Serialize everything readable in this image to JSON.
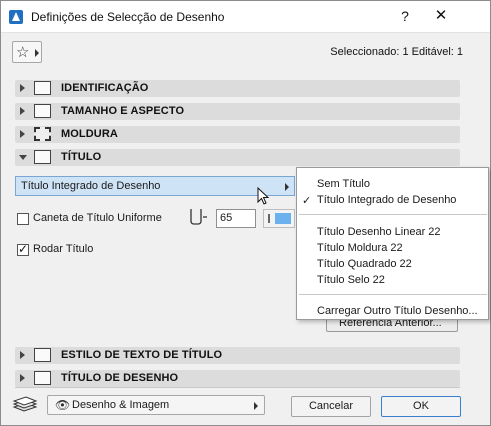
{
  "window": {
    "title": "Definições de Selecção de Desenho",
    "help_label": "?",
    "close_label": "✕"
  },
  "header": {
    "selected_info": "Seleccionado: 1 Editável: 1"
  },
  "sections": [
    {
      "label": "IDENTIFICAÇÃO",
      "icon": "identification-icon",
      "expanded": false
    },
    {
      "label": "TAMANHO E ASPECTO",
      "icon": "size-aspect-icon",
      "expanded": false
    },
    {
      "label": "MOLDURA",
      "icon": "frame-icon",
      "expanded": false
    },
    {
      "label": "TÍTULO",
      "icon": "title-icon",
      "expanded": true
    },
    {
      "label": "ESTILO DE TEXTO DE TÍTULO",
      "icon": "text-style-icon",
      "expanded": false
    },
    {
      "label": "TÍTULO DE DESENHO",
      "icon": "drawing-title-icon",
      "expanded": false
    }
  ],
  "title_panel": {
    "dropdown_value": "Título Integrado de Desenho",
    "uniform_pen_label": "Caneta de Título Uniforme",
    "uniform_pen_checked": false,
    "pen_value": "65",
    "pen_color": "#6ab1ee",
    "rotate_label": "Rodar Título",
    "rotate_checked": true,
    "reference_button_label": "Referência Anterior..."
  },
  "popup_menu": {
    "items": [
      {
        "label": "Sem Título",
        "checked": false
      },
      {
        "label": "Título Integrado de Desenho",
        "checked": true
      },
      {
        "label": "Título Desenho Linear 22",
        "checked": false
      },
      {
        "label": "Título Moldura 22",
        "checked": false
      },
      {
        "label": "Título Quadrado 22",
        "checked": false
      },
      {
        "label": "Título Selo 22",
        "checked": false
      },
      {
        "label": "Carregar Outro Título Desenho...",
        "checked": false
      }
    ],
    "check_glyph": "✓"
  },
  "footer": {
    "view_select_value": "Desenho & Imagem",
    "cancel_label": "Cancelar",
    "ok_label": "OK"
  },
  "colors": {
    "accent": "#3a7fcf",
    "highlight": "#cfe3f7",
    "section_bar": "#dcdcdc"
  }
}
